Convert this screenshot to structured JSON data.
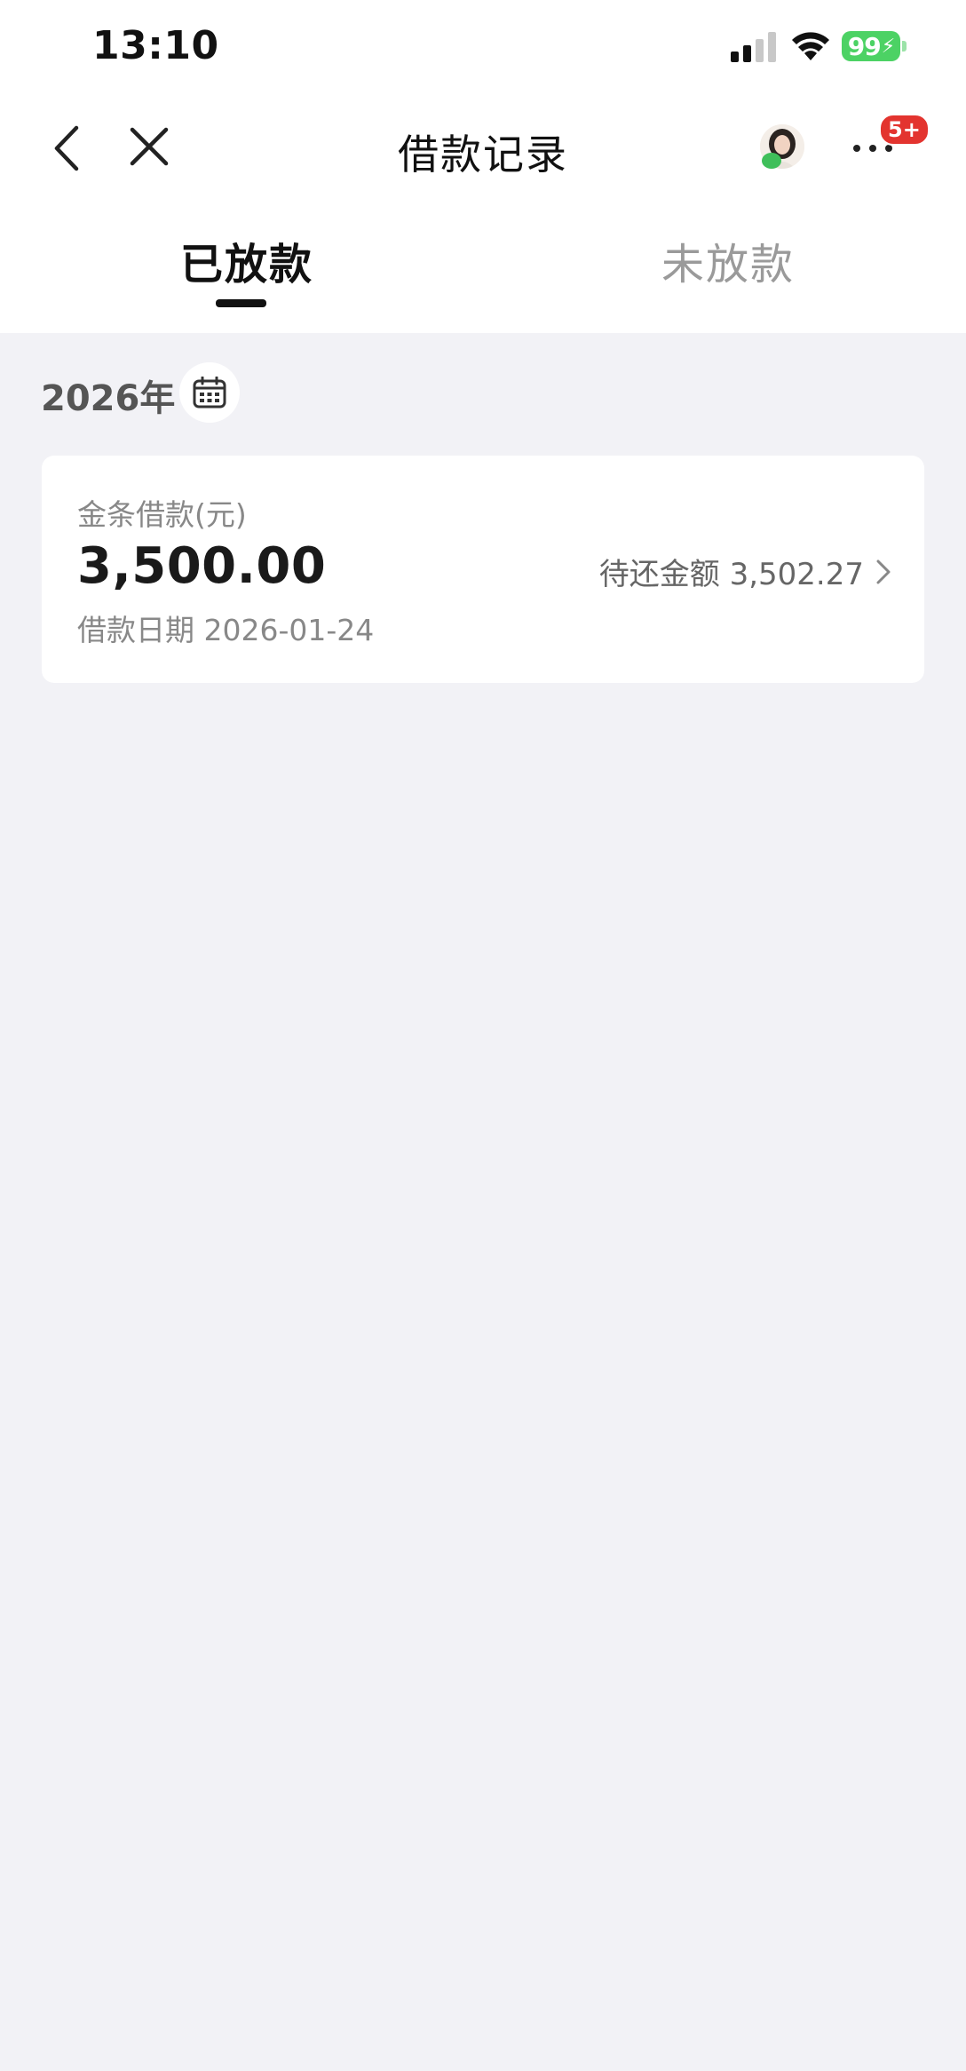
{
  "status_bar": {
    "time": "13:10",
    "battery": "99",
    "battery_color": "#4cd264",
    "icons": [
      "signal-icon",
      "wifi-icon",
      "battery-icon"
    ]
  },
  "nav": {
    "title": "借款记录",
    "badge": "5+",
    "icons": [
      "back-icon",
      "close-icon",
      "avatar",
      "more-icon"
    ]
  },
  "tabs": [
    {
      "label": "已放款",
      "active": true
    },
    {
      "label": "未放款",
      "active": false
    }
  ],
  "year": {
    "label": "2026年",
    "icon": "calendar-icon"
  },
  "records": [
    {
      "product_label": "金条借款(元)",
      "amount": "3,500.00",
      "date_label": "借款日期 2026-01-24",
      "due_label": "待还金额 3,502.27"
    }
  ],
  "colors": {
    "background": "#f2f2f6",
    "badge": "#e3342f",
    "accent": "#111111"
  }
}
